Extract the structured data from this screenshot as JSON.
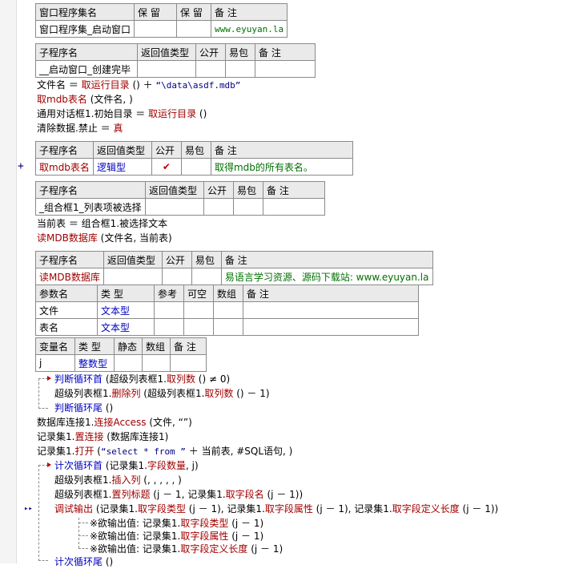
{
  "gutter": {
    "plus": "+",
    "current": "▸▸"
  },
  "program_set": {
    "headers": [
      "窗口程序集名",
      "保 留",
      "保 留",
      "备 注"
    ],
    "name": "窗口程序集_启动窗口",
    "note": "www.eyuyan.la"
  },
  "sub1": {
    "headers": [
      "子程序名",
      "返回值类型",
      "公开",
      "易包",
      "备 注"
    ],
    "name": "__启动窗口_创建完毕"
  },
  "code1": [
    {
      "a": "文件名 ＝ ",
      "b": "取运行目录",
      "c": " () ＋ ",
      "d": "“\\data\\asdf.mdb”"
    },
    {
      "a": "",
      "b": "取mdb表名",
      "c": " (文件名, )",
      "d": ""
    },
    {
      "a": "通用对话框1.初始目录 ＝ ",
      "b": "取运行目录",
      "c": " ()",
      "d": ""
    },
    {
      "a": "清除数据.禁止 ＝ ",
      "b": "真",
      "c": "",
      "d": ""
    }
  ],
  "sub2": {
    "headers": [
      "子程序名",
      "返回值类型",
      "公开",
      "易包",
      "备 注"
    ],
    "name": "取mdb表名",
    "ret": "逻辑型",
    "public": "✔",
    "note": "取得mdb的所有表名。"
  },
  "sub3": {
    "headers": [
      "子程序名",
      "返回值类型",
      "公开",
      "易包",
      "备 注"
    ],
    "name": "_组合框1_列表项被选择"
  },
  "code2": [
    {
      "a": "当前表 ＝ 组合框1.被选择文本",
      "b": "",
      "c": ""
    },
    {
      "a": "",
      "b": "读MDB数据库",
      "c": " (文件名, 当前表)"
    }
  ],
  "sub4": {
    "headers": [
      "子程序名",
      "返回值类型",
      "公开",
      "易包",
      "备 注"
    ],
    "name": "读MDB数据库",
    "note": "易语言学习资源、源码下载站: www.eyuyan.la",
    "param_headers": [
      "参数名",
      "类 型",
      "参考",
      "可空",
      "数组",
      "备 注"
    ],
    "params": [
      {
        "name": "文件",
        "type": "文本型"
      },
      {
        "name": "表名",
        "type": "文本型"
      }
    ]
  },
  "vars": {
    "headers": [
      "变量名",
      "类 型",
      "静态",
      "数组",
      "备 注"
    ],
    "rows": [
      {
        "name": "j",
        "type": "整数型"
      }
    ]
  },
  "code3": {
    "l1a": "判断循环首",
    "l1b": " (超级列表框1.",
    "l1c": "取列数",
    "l1d": " () ≠ 0)",
    "l2a": "超级列表框1.",
    "l2b": "删除列",
    "l2c": " (超级列表框1.",
    "l2d": "取列数",
    "l2e": " () － 1)",
    "l3a": "判断循环尾",
    "l3b": " ()",
    "l4a": "数据库连接1.",
    "l4b": "连接Access",
    "l4c": " (文件, “”)",
    "l5a": "记录集1.",
    "l5b": "置连接",
    "l5c": " (数据库连接1)",
    "l6a": "记录集1.",
    "l6b": "打开",
    "l6c": " (",
    "l6d": "“select * from ”",
    "l6e": " ＋ 当前表, #SQL语句, )",
    "l7a": "计次循环首",
    "l7b": " (记录集1.",
    "l7c": "字段数量",
    "l7d": ", j)",
    "l8a": "超级列表框1.",
    "l8b": "插入列",
    "l8c": " (, , , , , )",
    "l9a": "超级列表框1.",
    "l9b": "置列标题",
    "l9c": " (j － 1, 记录集1.",
    "l9d": "取字段名",
    "l9e": " (j － 1))",
    "l10a": "调试输出",
    "l10b": " (记录集1.",
    "l10c": "取字段类型",
    "l10d": " (j － 1), 记录集1.",
    "l10e": "取字段属性",
    "l10f": " (j － 1), 记录集1.",
    "l10g": "取字段定义长度",
    "l10h": " (j － 1))",
    "l11a": "※欲输出值: 记录集1.",
    "l11b": "取字段类型",
    "l11c": " (j － 1)",
    "l12a": "※欲输出值: 记录集1.",
    "l12b": "取字段属性",
    "l12c": " (j － 1)",
    "l13a": "※欲输出值: 记录集1.",
    "l13b": "取字段定义长度",
    "l13c": " (j － 1)",
    "l14a": "计次循环尾",
    "l14b": " ()"
  }
}
